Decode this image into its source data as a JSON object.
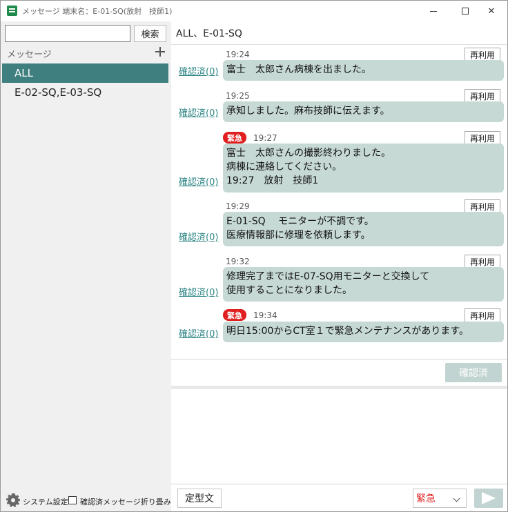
{
  "window": {
    "title": "メッセージ 端末名：E-01-SQ(放射　技師1)",
    "minimize": "—",
    "maximize": "☐",
    "close": "✕"
  },
  "sidebar": {
    "search_placeholder": "",
    "search_button": "検索",
    "section_label": "メッセージ",
    "conversations": [
      {
        "label": "ALL",
        "active": true
      },
      {
        "label": "E-02-SQ,E-03-SQ",
        "active": false
      }
    ],
    "settings_label": "システム設定",
    "fold_label": "確認済メッセージ折り畳み",
    "fold_checked": false
  },
  "main": {
    "title": "ALL、E-01-SQ",
    "messages": [
      {
        "time": "19:24",
        "urgent": false,
        "text": "富士　太郎さん病棟を出ました。",
        "confirm": "確認済(0)",
        "reuse": "再利用"
      },
      {
        "time": "19:25",
        "urgent": false,
        "text": "承知しました。麻布技師に伝えます。",
        "confirm": "確認済(0)",
        "reuse": "再利用"
      },
      {
        "time": "19:27",
        "urgent": true,
        "urgent_label": "緊急",
        "text": "富士　太郎さんの撮影終わりました。\n病棟に連絡してください。\n19:27　放射　技師1",
        "confirm": "確認済(0)",
        "reuse": "再利用"
      },
      {
        "time": "19:29",
        "urgent": false,
        "text": "E-01-SQ　 モニターが不調です。\n医療情報部に修理を依頼します。",
        "confirm": "確認済(0)",
        "reuse": "再利用"
      },
      {
        "time": "19:32",
        "urgent": false,
        "text": "修理完了まではE-07-SQ用モニターと交換して\n使用することになりました。",
        "confirm": "確認済(0)",
        "reuse": "再利用"
      },
      {
        "time": "19:34",
        "urgent": true,
        "urgent_label": "緊急",
        "text": "明日15:00からCT室１で緊急メンテナンスがあります。",
        "confirm": "確認済(0)",
        "reuse": "再利用"
      }
    ],
    "confirm_button": "確認済",
    "template_button": "定型文",
    "priority_value": "緊急"
  },
  "colors": {
    "accent": "#3f7f7f",
    "bubble": "#c6d9d5",
    "urgent": "#e02020",
    "link": "#2f8585"
  }
}
